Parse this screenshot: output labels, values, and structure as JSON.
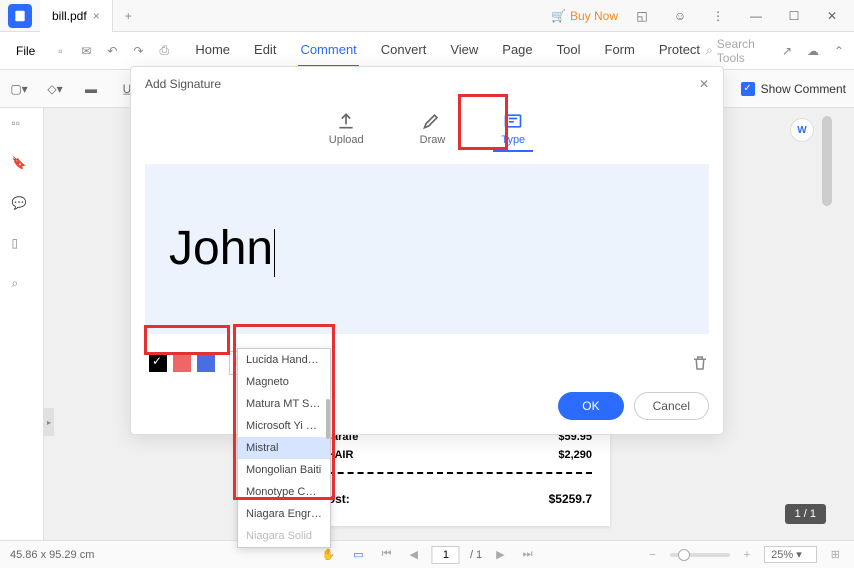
{
  "titlebar": {
    "tab_name": "bill.pdf",
    "buy_now": "Buy Now"
  },
  "menubar": {
    "file": "File",
    "tabs": [
      "Home",
      "Edit",
      "Comment",
      "Convert",
      "View",
      "Page",
      "Tool",
      "Form",
      "Protect"
    ],
    "active_tab": "Comment",
    "search_placeholder": "Search Tools"
  },
  "toolbar": {
    "show_comment": "Show Comment"
  },
  "dialog": {
    "title": "Add Signature",
    "tabs": {
      "upload": "Upload",
      "draw": "Draw",
      "type": "Type"
    },
    "signature_text": "John",
    "font_selected": "Mistral",
    "font_options": [
      "Lucida Handwrit...",
      "Magneto",
      "Matura MT Scrip...",
      "Microsoft Yi Baiti",
      "Mistral",
      "Mongolian Baiti",
      "Monotype Corsiva",
      "Niagara Engraved",
      "Niagara Solid"
    ],
    "ok": "OK",
    "cancel": "Cancel",
    "colors": {
      "black": "#000000",
      "red": "#e06666",
      "blue": "#4a6ee0"
    }
  },
  "document": {
    "rows": [
      {
        "name": "eather Carafe",
        "price": "$59.95"
      },
      {
        "name": "NING CHAIR",
        "price": "$2,290"
      }
    ],
    "total_label": "Total Cost:",
    "total_value": "$5259.7"
  },
  "statusbar": {
    "coords": "45.86 x 95.29 cm",
    "page_current": "1",
    "page_total": "/ 1",
    "zoom": "25%",
    "page_badge": "1 / 1"
  }
}
